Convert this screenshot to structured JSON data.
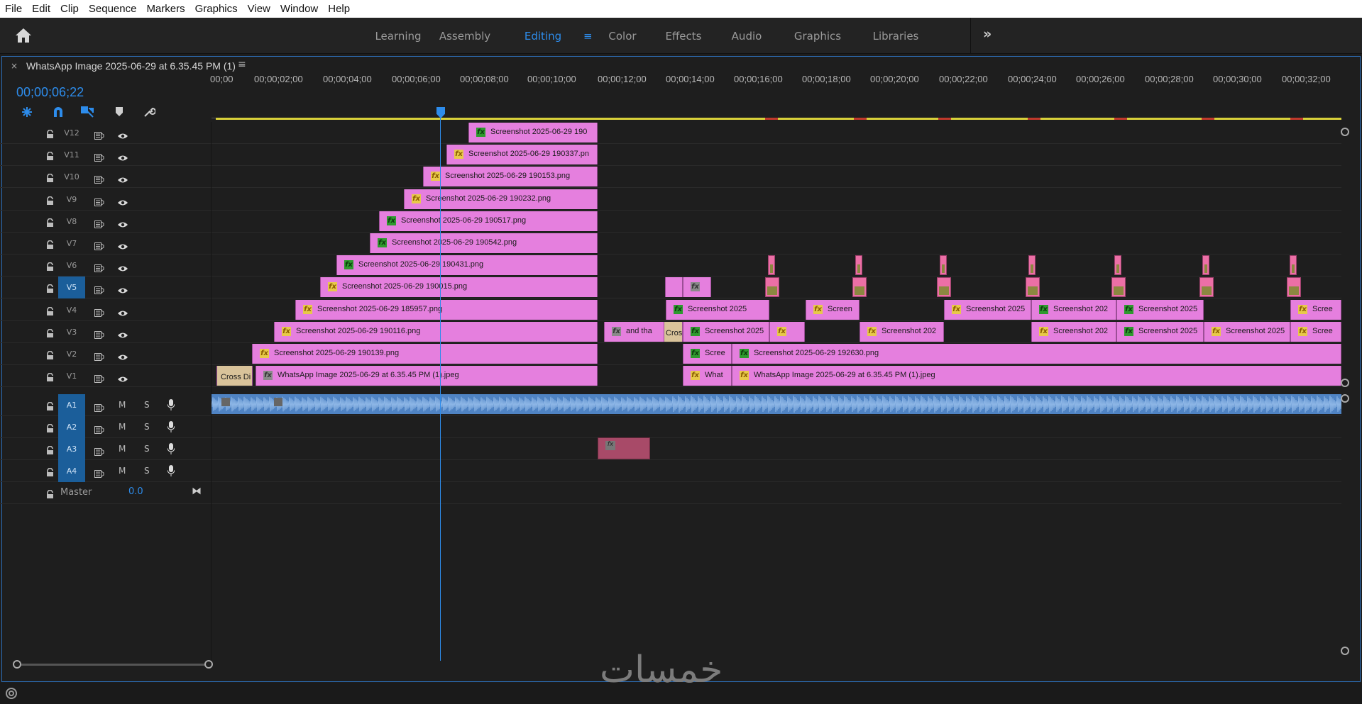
{
  "menu": [
    "File",
    "Edit",
    "Clip",
    "Sequence",
    "Markers",
    "Graphics",
    "View",
    "Window",
    "Help"
  ],
  "workspaces": [
    {
      "label": "Learning",
      "active": false
    },
    {
      "label": "Assembly",
      "active": false
    },
    {
      "label": "Editing",
      "active": true
    },
    {
      "label": "Color",
      "active": false
    },
    {
      "label": "Effects",
      "active": false
    },
    {
      "label": "Audio",
      "active": false
    },
    {
      "label": "Graphics",
      "active": false
    },
    {
      "label": "Libraries",
      "active": false
    }
  ],
  "panel": {
    "close": "×",
    "title": "WhatsApp Image 2025-06-29 at 6.35.45 PM (1)",
    "menu": "≡",
    "timecode": "00;00;06;22"
  },
  "ruler": [
    "00;00",
    "00;00;02;00",
    "00;00;04;00",
    "00;00;06;00",
    "00;00;08;00",
    "00;00;10;00",
    "00;00;12;00",
    "00;00;14;00",
    "00;00;16;00",
    "00;00;18;00",
    "00;00;20;00",
    "00;00;22;00",
    "00;00;24;00",
    "00;00;26;00",
    "00;00;28;00",
    "00;00;30;00",
    "00;00;32;00"
  ],
  "video_tracks": [
    "V12",
    "V11",
    "V10",
    "V9",
    "V8",
    "V7",
    "V6",
    "V5",
    "V4",
    "V3",
    "V2",
    "V1"
  ],
  "audio_tracks": [
    "A1",
    "A2",
    "A3",
    "A4"
  ],
  "audio_buttons": {
    "mute": "M",
    "solo": "S"
  },
  "master": {
    "label": "Master",
    "value": "0.0"
  },
  "clips": {
    "v12": "Screenshot 2025-06-29 190",
    "v11": "Screenshot 2025-06-29 190337.pn",
    "v10": "Screenshot 2025-06-29 190153.png",
    "v9": "Screenshot 2025-06-29 190232.png",
    "v8": "Screenshot 2025-06-29 190517.png",
    "v7": "Screenshot 2025-06-29 190542.png",
    "v6": "Screenshot 2025-06-29 190431.png",
    "v5": "Screenshot 2025-06-29 190015.png",
    "v4": "Screenshot 2025-06-29 185957.png",
    "v3": "Screenshot 2025-06-29 190116.png",
    "v2": "Screenshot 2025-06-29 190139.png",
    "v1": "WhatsApp Image 2025-06-29 at 6.35.45 PM (1).jpeg",
    "v1_cross": "Cross Di",
    "v3_andtha": "and tha",
    "v3_cross": "Cros",
    "v4_a": "Screenshot 2025",
    "v4_b": "Screen",
    "v4_c": "Screenshot 2025",
    "v4_d": "Screenshot 202",
    "v4_e": "Screenshot 2025",
    "v4_f": "Scree",
    "v3_a": "Screenshot 2025",
    "v3_b": "Screenshot 202",
    "v3_c": "Screenshot 202",
    "v3_d": "Screenshot 2025",
    "v3_e": "Screenshot 2025",
    "v3_f": "Scree",
    "v2_a": "Scree",
    "v2_b": "Screenshot 2025-06-29 192630.png",
    "v1_a": "What",
    "v1_b": "WhatsApp Image 2025-06-29 at 6.35.45 PM (1).jpeg",
    "fx": "fx"
  },
  "watermark": "خمسات",
  "colors": {
    "accent": "#2d8ceb",
    "clip": "#e57fde",
    "audio": "#4f83c3"
  }
}
